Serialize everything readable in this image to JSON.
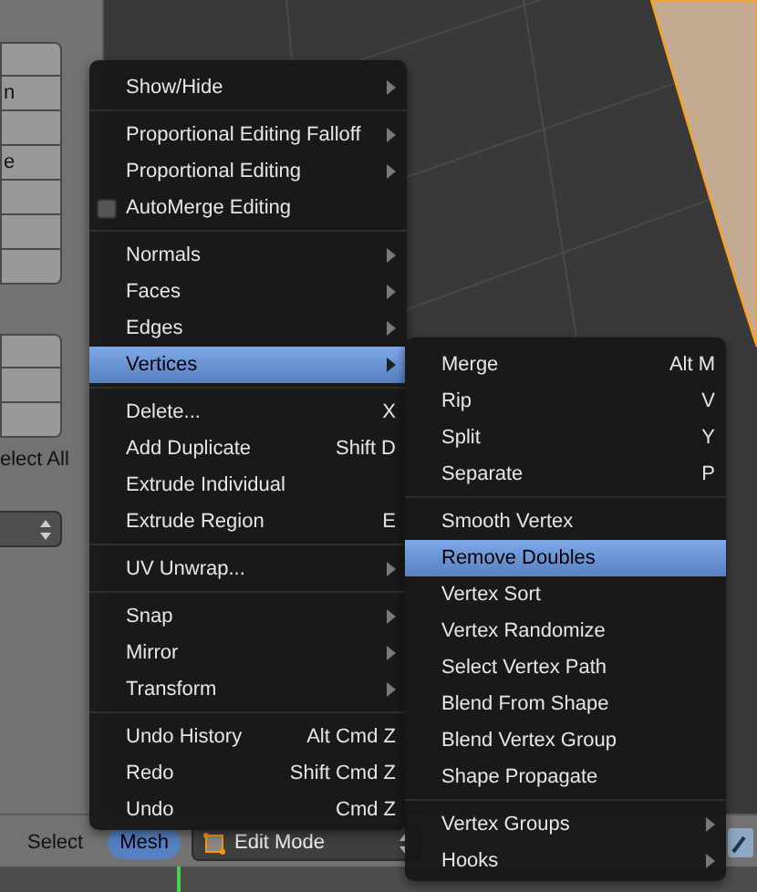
{
  "tool_shelf": {
    "partial_labels": [
      "n",
      "e"
    ],
    "select_partial": "elect All"
  },
  "mesh_menu": {
    "sections": [
      [
        {
          "label": "Show/Hide",
          "kind": "submenu",
          "selected": false
        }
      ],
      [
        {
          "label": "Proportional Editing Falloff",
          "kind": "submenu",
          "selected": false
        },
        {
          "label": "Proportional Editing",
          "kind": "submenu",
          "selected": false
        },
        {
          "label": "AutoMerge Editing",
          "kind": "checkbox",
          "checked": false,
          "selected": false
        }
      ],
      [
        {
          "label": "Normals",
          "kind": "submenu",
          "selected": false
        },
        {
          "label": "Faces",
          "kind": "submenu",
          "selected": false
        },
        {
          "label": "Edges",
          "kind": "submenu",
          "selected": false
        },
        {
          "label": "Vertices",
          "kind": "submenu",
          "selected": true
        }
      ],
      [
        {
          "label": "Delete...",
          "kind": "action",
          "shortcut": "X",
          "selected": false
        },
        {
          "label": "Add Duplicate",
          "kind": "action",
          "shortcut": "Shift D",
          "selected": false
        },
        {
          "label": "Extrude Individual",
          "kind": "action",
          "selected": false
        },
        {
          "label": "Extrude Region",
          "kind": "action",
          "shortcut": "E",
          "selected": false
        }
      ],
      [
        {
          "label": "UV Unwrap...",
          "kind": "submenu",
          "selected": false
        }
      ],
      [
        {
          "label": "Snap",
          "kind": "submenu",
          "selected": false
        },
        {
          "label": "Mirror",
          "kind": "submenu",
          "selected": false
        },
        {
          "label": "Transform",
          "kind": "submenu",
          "selected": false
        }
      ],
      [
        {
          "label": "Undo History",
          "kind": "action",
          "shortcut": "Alt Cmd Z",
          "selected": false
        },
        {
          "label": "Redo",
          "kind": "action",
          "shortcut": "Shift Cmd Z",
          "selected": false
        },
        {
          "label": "Undo",
          "kind": "action",
          "shortcut": "Cmd Z",
          "selected": false
        }
      ]
    ]
  },
  "vertices_menu": {
    "sections": [
      [
        {
          "label": "Merge",
          "kind": "action",
          "shortcut": "Alt M",
          "selected": false
        },
        {
          "label": "Rip",
          "kind": "action",
          "shortcut": "V",
          "selected": false
        },
        {
          "label": "Split",
          "kind": "action",
          "shortcut": "Y",
          "selected": false
        },
        {
          "label": "Separate",
          "kind": "action",
          "shortcut": "P",
          "selected": false
        }
      ],
      [
        {
          "label": "Smooth Vertex",
          "kind": "action",
          "selected": false
        },
        {
          "label": "Remove Doubles",
          "kind": "action",
          "selected": true
        },
        {
          "label": "Vertex Sort",
          "kind": "action",
          "selected": false
        },
        {
          "label": "Vertex Randomize",
          "kind": "action",
          "selected": false
        },
        {
          "label": "Select Vertex Path",
          "kind": "action",
          "selected": false
        },
        {
          "label": "Blend From Shape",
          "kind": "action",
          "selected": false
        },
        {
          "label": "Blend Vertex Group",
          "kind": "action",
          "selected": false
        },
        {
          "label": "Shape Propagate",
          "kind": "action",
          "selected": false
        }
      ],
      [
        {
          "label": "Vertex Groups",
          "kind": "submenu",
          "selected": false
        },
        {
          "label": "Hooks",
          "kind": "submenu",
          "selected": false
        }
      ]
    ]
  },
  "header": {
    "menus": [
      {
        "label": "Select",
        "selected": false
      },
      {
        "label": "Mesh",
        "selected": true
      }
    ],
    "mode": "Edit Mode"
  }
}
